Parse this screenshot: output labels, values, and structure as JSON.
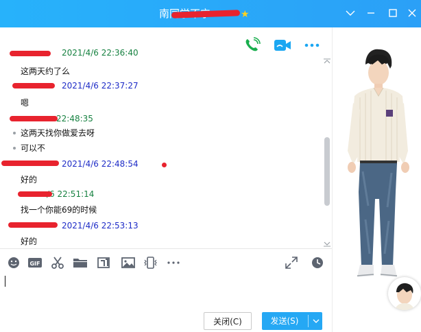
{
  "window": {
    "title": "南同学不宁",
    "controls": [
      "chevron-down-icon",
      "minimize-icon",
      "maximize-icon",
      "close-icon"
    ]
  },
  "header_icons": [
    "voice-call-icon",
    "video-call-icon",
    "more-icon"
  ],
  "messages": [
    {
      "type": "sender",
      "color": "green",
      "name": "",
      "time": "2021/4/6 22:36:40",
      "partial": true
    },
    {
      "type": "text",
      "text": "这两天约了么",
      "bullet": false
    },
    {
      "type": "sender",
      "color": "blue",
      "name": "",
      "time": "2021/4/6 22:37:27"
    },
    {
      "type": "text",
      "text": "嗯",
      "bullet": false
    },
    {
      "type": "sender",
      "color": "green",
      "name": "",
      "time": "22:48:35"
    },
    {
      "type": "text",
      "text": "这两天找你做爱去呀",
      "bullet": true
    },
    {
      "type": "text",
      "text": "可以不",
      "bullet": true
    },
    {
      "type": "sender",
      "color": "blue",
      "name": "",
      "time": "2021/4/6 22:48:54"
    },
    {
      "type": "text",
      "text": "好的",
      "bullet": false
    },
    {
      "type": "sender",
      "color": "green",
      "name": "",
      "time": "/6 22:51:14"
    },
    {
      "type": "text",
      "text": "找一个你能69的时候",
      "bullet": false
    },
    {
      "type": "sender",
      "color": "blue",
      "name": "",
      "time": "2021/4/6 22:53:13"
    },
    {
      "type": "text",
      "text": "好的",
      "bullet": false
    }
  ],
  "toolbar": [
    "emoji-icon",
    "gif-icon",
    "scissors-icon",
    "folder-icon",
    "image-search-icon",
    "image-icon",
    "phone-shake-icon",
    "more-dots-icon",
    "expand-icon",
    "history-clock-icon"
  ],
  "input": {
    "value": ""
  },
  "buttons": {
    "close": "关闭(C)",
    "send": "发送(S)"
  },
  "colors": {
    "titlebar": "#27b2fb",
    "sender_blue": "#1d2bc7",
    "sender_green": "#168140",
    "send_button": "#25a8f4",
    "redaction": "#e8232e"
  }
}
